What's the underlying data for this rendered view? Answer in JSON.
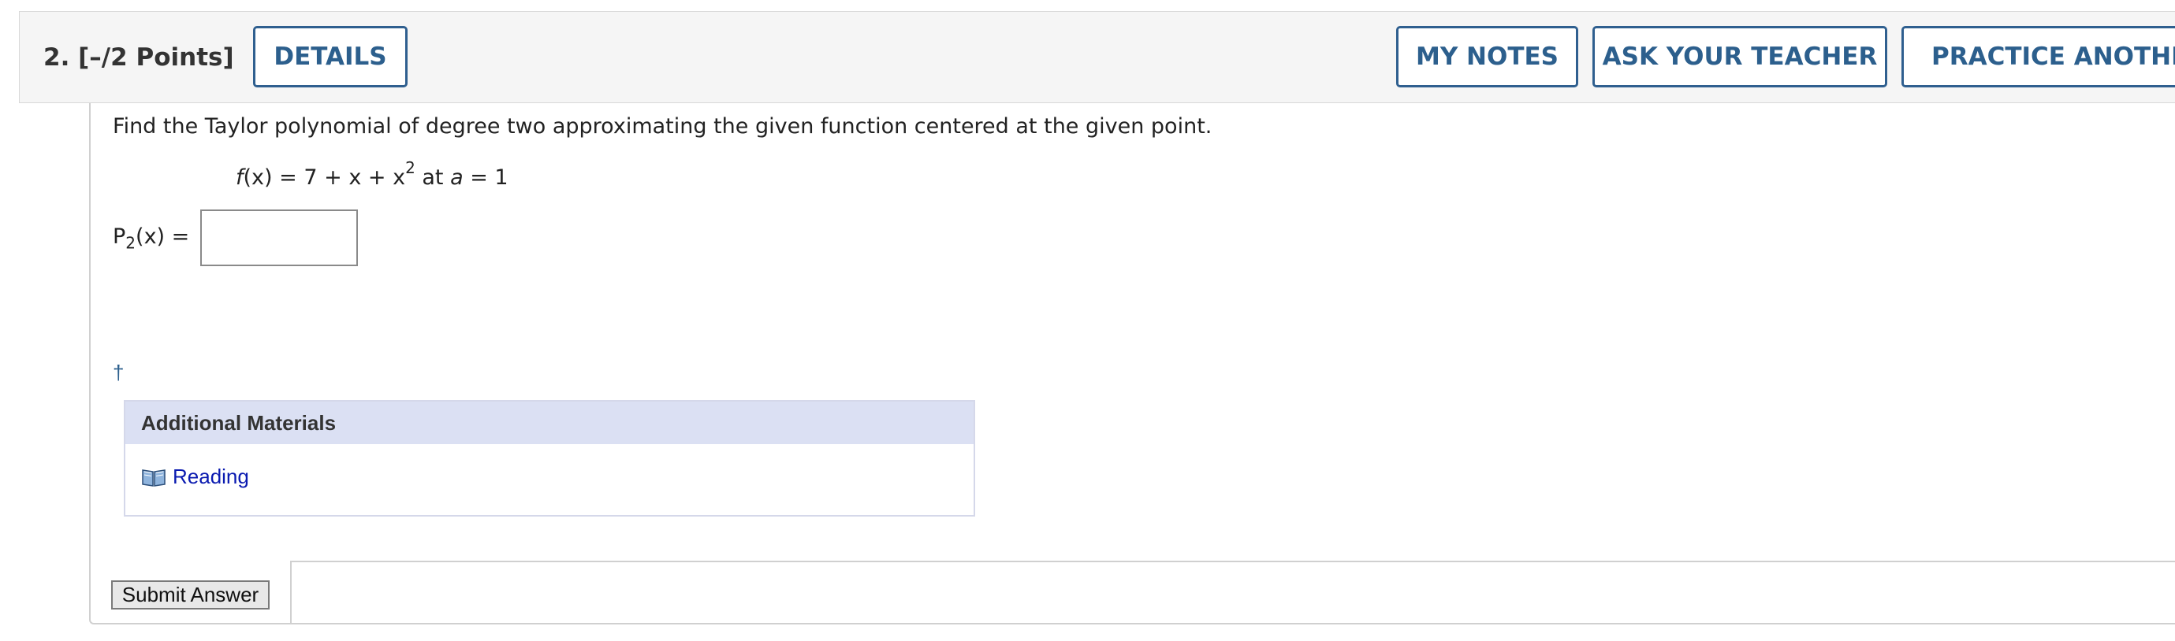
{
  "question": {
    "number_points": "2.  [–/2 Points]",
    "details_label": "DETAILS",
    "my_notes_label": "MY NOTES",
    "ask_teacher_label": "ASK YOUR TEACHER",
    "practice_label": "PRACTICE ANOTHER"
  },
  "body": {
    "prompt": "Find the Taylor polynomial of degree two approximating the given function centered at the given point.",
    "function_fx": "f",
    "function_expr_start": "(x) = 7 + x + x",
    "function_exp": "2",
    "function_at": " at ",
    "function_a": "a",
    "function_eq": " = 1",
    "answer_p": "P",
    "answer_sub": "2",
    "answer_tail": "(x) =",
    "answer_value": "",
    "dagger": "†"
  },
  "materials": {
    "heading": "Additional Materials",
    "link_label": "Reading",
    "link_icon": "book-icon"
  },
  "submit_label": "Submit Answer",
  "colors": {
    "button_border": "#2f5f8f",
    "button_text": "#2c5f8d",
    "materials_header": "#dbe0f3",
    "link": "#0a1ab0"
  }
}
